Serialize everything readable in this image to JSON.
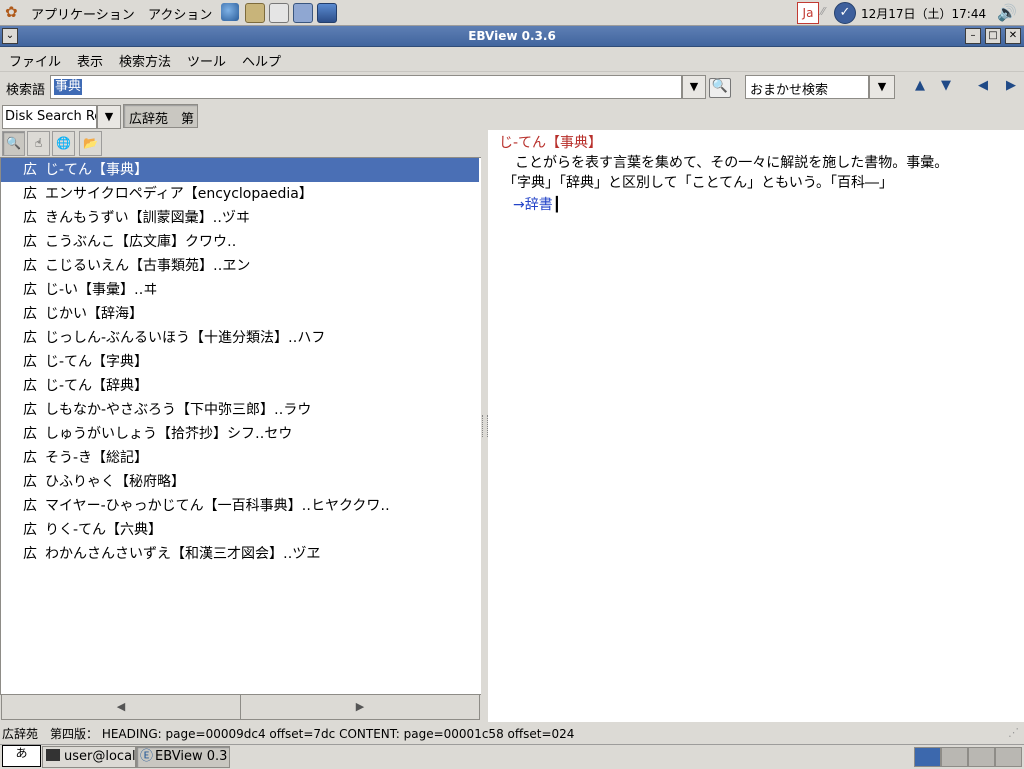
{
  "top_panel": {
    "menus": [
      "アプリケーション",
      "アクション"
    ],
    "launchers": [
      "browser-icon",
      "mail-icon",
      "editor-icon",
      "office-icon",
      "terminal-icon"
    ],
    "ime_label": "Ja",
    "clock": "12月17日（土）17:44"
  },
  "window": {
    "title": "EBView 0.3.6"
  },
  "menubar": [
    "ファイル",
    "表示",
    "検索方法",
    "ツール",
    "ヘルプ"
  ],
  "search": {
    "label": "検索語",
    "value": "事典",
    "method": "おまかせ検索"
  },
  "dictionary": {
    "group": "Disk Search Re",
    "selected": "広辞苑　第"
  },
  "results": [
    {
      "dict": "広",
      "word": "じ‐てん【事典】",
      "selected": true
    },
    {
      "dict": "広",
      "word": "エンサイクロペディア【encyclopaedia】"
    },
    {
      "dict": "広",
      "word": "きんもうずい【訓蒙図彙】‥ヅヰ"
    },
    {
      "dict": "広",
      "word": "こうぶんこ【広文庫】クワウ‥"
    },
    {
      "dict": "広",
      "word": "こじるいえん【古事類苑】‥ヱン"
    },
    {
      "dict": "広",
      "word": "じ‐い【事彙】‥ヰ"
    },
    {
      "dict": "広",
      "word": "じかい【辞海】"
    },
    {
      "dict": "広",
      "word": "じっしん‐ぶんるいほう【十進分類法】‥ハフ"
    },
    {
      "dict": "広",
      "word": "じ‐てん【字典】"
    },
    {
      "dict": "広",
      "word": "じ‐てん【辞典】"
    },
    {
      "dict": "広",
      "word": "しもなか‐やさぶろう【下中弥三郎】‥ラウ"
    },
    {
      "dict": "広",
      "word": "しゅうがいしょう【拾芥抄】シフ‥セウ"
    },
    {
      "dict": "広",
      "word": "そう‐き【総記】"
    },
    {
      "dict": "広",
      "word": "ひふりゃく【秘府略】"
    },
    {
      "dict": "広",
      "word": "マイヤー‐ひゃっかじてん【一百科事典】‥ヒヤククワ‥"
    },
    {
      "dict": "広",
      "word": "りく‐てん【六典】"
    },
    {
      "dict": "広",
      "word": "わかんさんさいずえ【和漢三才図会】‥ヅヱ"
    }
  ],
  "content": {
    "heading": "じ‐てん【事典】",
    "lines": [
      "ことがらを表す言葉を集めて、その一々に解説を施した書物。事彙。",
      "「字典」「辞典」と区別して「ことてん」ともいう。「百科―」"
    ],
    "link": "→辞書",
    "cursor": "┃"
  },
  "status": "広辞苑　第四版： HEADING: page=00009dc4 offset=7dc   CONTENT: page=00001c58 offset=024",
  "taskbar": {
    "ime": "あ",
    "tasks": [
      "user@local",
      "EBView 0.3"
    ]
  },
  "colors": {
    "selection": "#4a6fb5",
    "heading_red": "#b8302b",
    "link_blue": "#2444c8",
    "titlebar": "#41659e"
  }
}
